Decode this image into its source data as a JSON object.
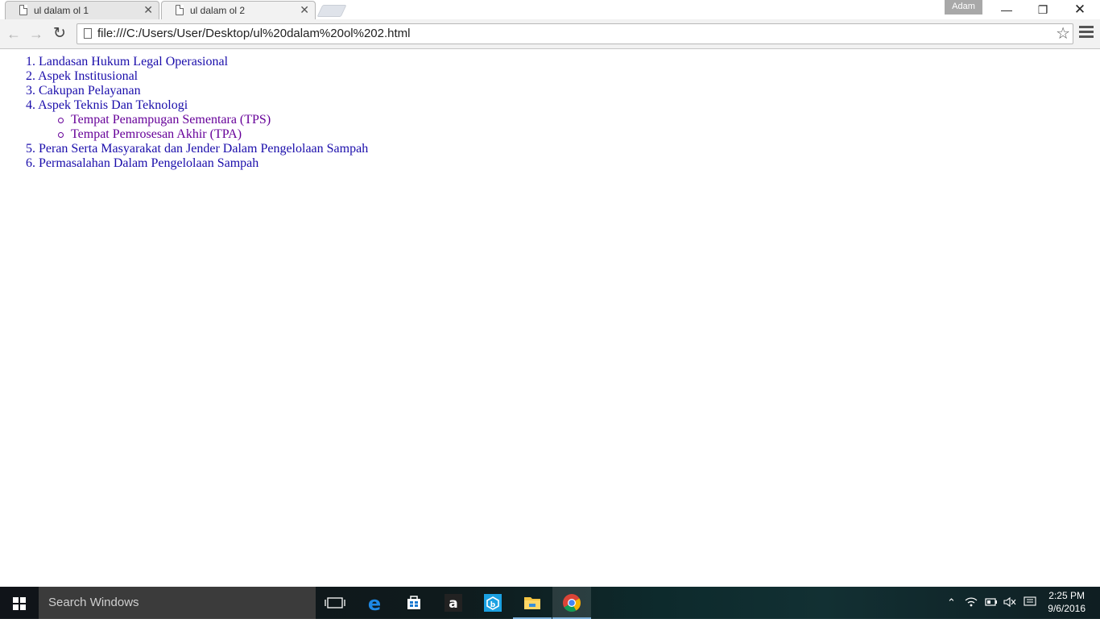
{
  "window": {
    "profile_name": "Adam"
  },
  "tabs": [
    {
      "title": "ul dalam ol 1",
      "active": false
    },
    {
      "title": "ul dalam ol 2",
      "active": true
    }
  ],
  "toolbar": {
    "url": "file:///C:/Users/User/Desktop/ul%20dalam%20ol%202.html"
  },
  "page": {
    "ordered_list": [
      {
        "num": "1.",
        "text": "Landasan Hukum Legal Operasional"
      },
      {
        "num": "2.",
        "text": "Aspek Institusional"
      },
      {
        "num": "3.",
        "text": "Cakupan Pelayanan"
      },
      {
        "num": "4.",
        "text": "Aspek Teknis Dan Teknologi"
      },
      {
        "num": "5.",
        "text": "Peran Serta Masyarakat dan Jender Dalam Pengelolaan Sampah"
      },
      {
        "num": "6.",
        "text": "Permasalahan Dalam Pengelolaan Sampah"
      }
    ],
    "nested_list": [
      {
        "text": "Tempat Penampugan Sementara (TPS)"
      },
      {
        "text": "Tempat Pemrosesan Akhir (TPA)"
      }
    ]
  },
  "taskbar": {
    "search_placeholder": "Search Windows",
    "time": "2:25 PM",
    "date": "9/6/2016",
    "pinned": [
      "task-view-icon",
      "edge-icon",
      "store-icon",
      "amazon-icon",
      "app-icon",
      "file-explorer-icon",
      "chrome-icon"
    ]
  },
  "colors": {
    "link": "#1a0dab",
    "visited": "#660099",
    "taskbar_search": "#3b3b3b"
  }
}
